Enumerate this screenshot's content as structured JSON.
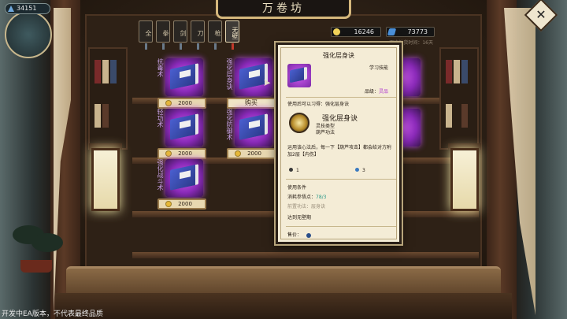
{
  "hud": {
    "player_id": "34151",
    "coins": "16246",
    "gems": "73773",
    "refresh_text": "下次补货时间：16天"
  },
  "shop": {
    "title": "万卷坊",
    "tabs": [
      {
        "label": "全",
        "active": false
      },
      {
        "label": "拳",
        "active": false
      },
      {
        "label": "剑",
        "active": false
      },
      {
        "label": "刀",
        "active": false
      },
      {
        "label": "枪",
        "active": false
      },
      {
        "label": "无壁",
        "active": true
      }
    ],
    "items": [
      {
        "side_label": "抗毒术",
        "price": "2000"
      },
      {
        "side_label": "强化层身诀",
        "price": "购买"
      },
      {
        "side_label": "",
        "price": ""
      },
      {
        "side_label": "轻功术",
        "price": "2000"
      },
      {
        "side_label": "强化防御术",
        "price": "2000"
      },
      {
        "side_label": "",
        "price": ""
      },
      {
        "side_label": "强化战斗术",
        "price": "2000"
      }
    ]
  },
  "detail": {
    "title": "强化层身诀",
    "kind": "学习技能",
    "grade_label": "品级：",
    "grade_value": "灵品",
    "learn_text": "使用后可以习得：强化层身诀",
    "skill_name": "强化层身诀",
    "skill_type_1": "灵技类型",
    "skill_type_2": "葫芦功法",
    "skill_desc": "运用该心法后，每一下【葫芦攻击】都会给对方附加2层【内伤】",
    "stat_cooldown": "1",
    "stat_cost": "3",
    "conditions_title": "使用条件",
    "cond_1_label": "消耗参悟点：",
    "cond_1_value": "78/3",
    "cond_2_label": "前置功法：",
    "cond_2_value": "层身诀",
    "cond_3": "达到无壁期",
    "price_label": "售价："
  },
  "footer": {
    "notice": "开发中EA版本，不代表最终品质"
  }
}
